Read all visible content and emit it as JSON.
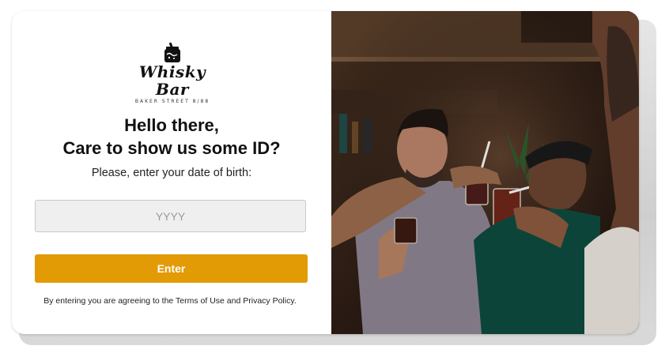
{
  "brand": {
    "name": "Whisky Bar",
    "tagline": "BAKER STREET 8/88",
    "logo_icon": "whisky-glass-icon"
  },
  "age_gate": {
    "heading_line1": "Hello there,",
    "heading_line2": "Care to show us some ID?",
    "prompt": "Please, enter your date of birth:",
    "year_placeholder": "YYYY",
    "year_value": "",
    "enter_label": "Enter",
    "terms_prefix": "By entering you are agreeing to the ",
    "terms_link": "Terms of Use",
    "terms_and": " and ",
    "privacy_link": "Privacy Policy",
    "terms_suffix": "."
  },
  "colors": {
    "accent": "#e29a05",
    "input_bg": "#efefef",
    "text": "#111111"
  },
  "photo": {
    "subject": "friends-toasting-cocktails-photo"
  }
}
